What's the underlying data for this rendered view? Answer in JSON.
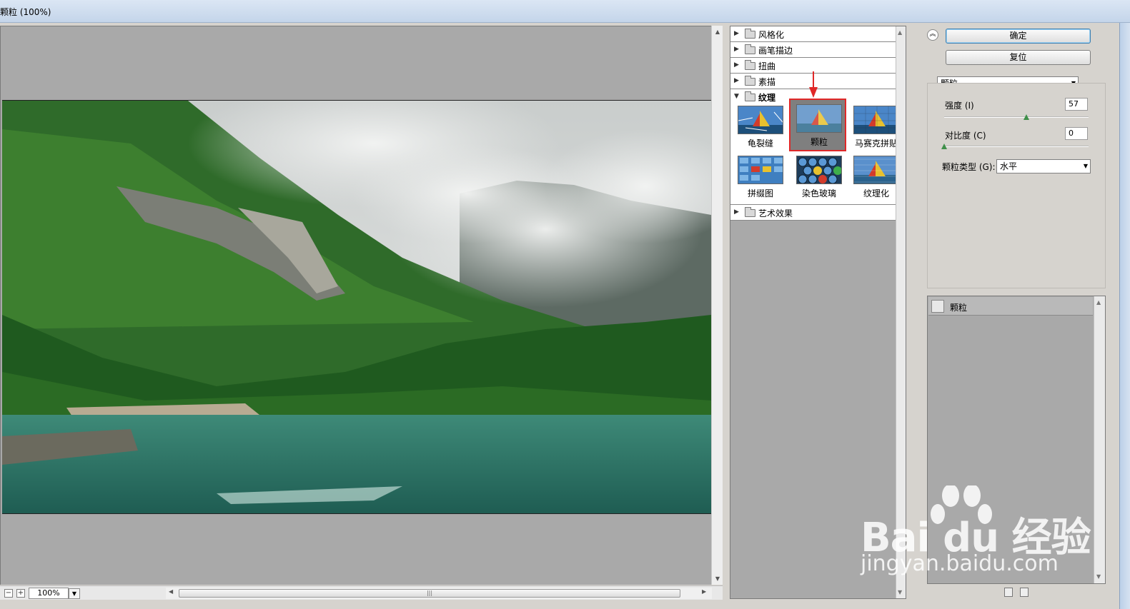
{
  "window": {
    "title": "颗粒 (100%)"
  },
  "preview": {
    "zoom": "100%",
    "zoom_out": "−",
    "zoom_in": "+"
  },
  "filter_categories": [
    {
      "label": "风格化",
      "expanded": false
    },
    {
      "label": "画笔描边",
      "expanded": false
    },
    {
      "label": "扭曲",
      "expanded": false
    },
    {
      "label": "素描",
      "expanded": false
    },
    {
      "label": "纹理",
      "expanded": true
    },
    {
      "label": "艺术效果",
      "expanded": false
    }
  ],
  "texture_filters": [
    {
      "label": "龟裂缝",
      "selected": false
    },
    {
      "label": "颗粒",
      "selected": true
    },
    {
      "label": "马赛克拼贴",
      "selected": false
    },
    {
      "label": "拼缀图",
      "selected": false
    },
    {
      "label": "染色玻璃",
      "selected": false
    },
    {
      "label": "纹理化",
      "selected": false
    }
  ],
  "buttons": {
    "ok": "确定",
    "reset": "复位"
  },
  "settings": {
    "filter_select": "颗粒",
    "intensity_label": "强度 (I)",
    "intensity_value": "57",
    "intensity_fraction": 0.57,
    "contrast_label": "对比度 (C)",
    "contrast_value": "0",
    "contrast_fraction": 0.0,
    "grain_type_label": "颗粒类型 (G):",
    "grain_type_value": "水平"
  },
  "effect_layers": [
    {
      "label": "颗粒"
    }
  ],
  "watermark": {
    "brand": "Bai du 经验",
    "url": "jingyan.baidu.com"
  },
  "colors": {
    "selection_border": "#e02828",
    "ok_border": "#3c7fb1",
    "knob": "#3f8f4a"
  }
}
